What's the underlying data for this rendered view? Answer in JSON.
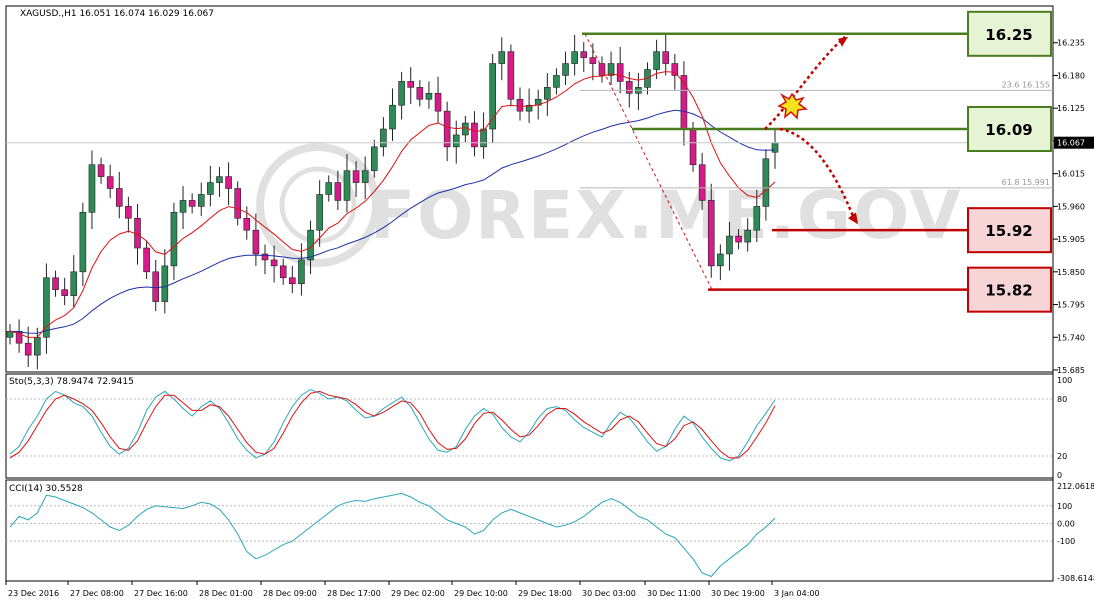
{
  "header": {
    "symbol_line": "XAGUSD.,H1  16.051 16.074 16.029 16.067",
    "watermark": "FOREX.ME.GOV"
  },
  "colors": {
    "bull_candle": "#2e8b57",
    "bear_candle": "#d81b8a",
    "ma_fast": "#e01010",
    "ma_slow": "#1c2fa8",
    "resistance": "#4b7d1e",
    "support": "#c00000",
    "stoch_main": "#2aa7b8",
    "stoch_signal": "#e01010",
    "cci": "#2aa7b8"
  },
  "chart_data": [
    {
      "type": "candlestick",
      "title": "XAGUSD.,H1",
      "ohlc_last": {
        "open": 16.051,
        "high": 16.074,
        "low": 16.029,
        "close": 16.067
      },
      "current_price": "16.067",
      "ylim": [
        15.685,
        16.29
      ],
      "y_ticks": [
        "16.235",
        "16.180",
        "16.125",
        "16.070",
        "16.015",
        "15.960",
        "15.905",
        "15.850",
        "15.795",
        "15.740",
        "15.685"
      ],
      "x_ticks": [
        "23 Dec 2016",
        "27 Dec 08:00",
        "27 Dec 16:00",
        "28 Dec 01:00",
        "28 Dec 09:00",
        "28 Dec 17:00",
        "29 Dec 02:00",
        "29 Dec 10:00",
        "29 Dec 18:00",
        "30 Dec 03:00",
        "30 Dec 11:00",
        "30 Dec 19:00",
        "3 Jan 04:00"
      ],
      "closes": [
        15.75,
        15.73,
        15.71,
        15.74,
        15.84,
        15.82,
        15.81,
        15.85,
        15.95,
        16.03,
        16.01,
        15.99,
        15.96,
        15.94,
        15.89,
        15.85,
        15.8,
        15.86,
        15.95,
        15.97,
        15.96,
        15.98,
        16.0,
        16.01,
        15.99,
        15.94,
        15.92,
        15.88,
        15.87,
        15.86,
        15.84,
        15.83,
        15.87,
        15.92,
        15.98,
        16.0,
        15.97,
        16.02,
        16.0,
        16.02,
        16.06,
        16.09,
        16.13,
        16.17,
        16.16,
        16.14,
        16.15,
        16.12,
        16.06,
        16.08,
        16.1,
        16.06,
        16.09,
        16.2,
        16.22,
        16.14,
        16.12,
        16.13,
        16.14,
        16.16,
        16.18,
        16.2,
        16.22,
        16.21,
        16.2,
        16.18,
        16.2,
        16.17,
        16.15,
        16.16,
        16.19,
        16.22,
        16.2,
        16.18,
        16.09,
        16.03,
        15.97,
        15.86,
        15.88,
        15.91,
        15.9,
        15.92,
        15.96,
        16.04,
        16.067
      ],
      "ma_fast_name": "",
      "ma_slow_name": "",
      "levels": [
        {
          "label": "16.25",
          "value": 16.25,
          "kind": "resistance"
        },
        {
          "label": "16.09",
          "value": 16.09,
          "kind": "resistance"
        },
        {
          "label": "15.92",
          "value": 15.92,
          "kind": "support"
        },
        {
          "label": "15.82",
          "value": 15.82,
          "kind": "support"
        }
      ],
      "fib": [
        {
          "label": "23.6 16.155",
          "value": 16.155
        },
        {
          "label": "61.8 15.991",
          "value": 15.991
        }
      ]
    },
    {
      "type": "line",
      "title": "Sto(5,3,3) 78.9474 72.9415",
      "ylim": [
        0,
        100
      ],
      "y_ticks": [
        "100",
        "80",
        "20",
        "0"
      ],
      "series": [
        {
          "name": "",
          "values": [
            22,
            30,
            48,
            62,
            80,
            88,
            84,
            76,
            72,
            62,
            45,
            30,
            22,
            28,
            45,
            68,
            82,
            88,
            80,
            70,
            62,
            72,
            78,
            70,
            55,
            38,
            26,
            18,
            22,
            35,
            55,
            72,
            84,
            90,
            86,
            80,
            82,
            78,
            68,
            60,
            62,
            70,
            76,
            82,
            72,
            55,
            38,
            26,
            24,
            30,
            48,
            62,
            70,
            64,
            50,
            40,
            35,
            45,
            60,
            70,
            72,
            68,
            58,
            50,
            45,
            40,
            55,
            66,
            60,
            48,
            35,
            25,
            30,
            48,
            62,
            55,
            40,
            28,
            18,
            15,
            20,
            35,
            52,
            65,
            78.9474
          ]
        },
        {
          "name": "",
          "values": [
            18,
            24,
            36,
            52,
            68,
            80,
            84,
            80,
            75,
            68,
            55,
            40,
            28,
            26,
            36,
            55,
            72,
            84,
            84,
            76,
            68,
            68,
            74,
            72,
            62,
            48,
            34,
            24,
            22,
            28,
            44,
            62,
            76,
            86,
            88,
            84,
            82,
            80,
            74,
            66,
            62,
            66,
            72,
            78,
            76,
            65,
            48,
            34,
            27,
            28,
            38,
            54,
            65,
            66,
            58,
            48,
            40,
            42,
            52,
            64,
            70,
            70,
            64,
            56,
            50,
            44,
            48,
            58,
            62,
            56,
            44,
            33,
            30,
            38,
            52,
            56,
            48,
            36,
            25,
            18,
            18,
            26,
            40,
            55,
            72.9415
          ]
        }
      ]
    },
    {
      "type": "line",
      "title": "CCI(14) 30.5528",
      "ylim": [
        -308.6148,
        212.0618
      ],
      "y_ticks": [
        "212.0618",
        "100",
        "0.00",
        "-100",
        "-308.6148"
      ],
      "series": [
        {
          "name": "",
          "values": [
            -20,
            40,
            20,
            60,
            160,
            150,
            130,
            110,
            90,
            60,
            20,
            -20,
            -40,
            -10,
            40,
            80,
            100,
            95,
            90,
            85,
            100,
            120,
            110,
            80,
            20,
            -60,
            -160,
            -200,
            -180,
            -150,
            -120,
            -100,
            -60,
            -20,
            20,
            60,
            100,
            120,
            130,
            125,
            140,
            150,
            160,
            170,
            150,
            120,
            100,
            60,
            20,
            0,
            -20,
            -60,
            -40,
            20,
            60,
            80,
            60,
            40,
            20,
            0,
            -20,
            -10,
            10,
            40,
            80,
            120,
            140,
            120,
            80,
            40,
            20,
            -20,
            -60,
            -80,
            -140,
            -200,
            -280,
            -300,
            -240,
            -200,
            -160,
            -120,
            -60,
            -20,
            30.5528
          ]
        }
      ]
    }
  ]
}
